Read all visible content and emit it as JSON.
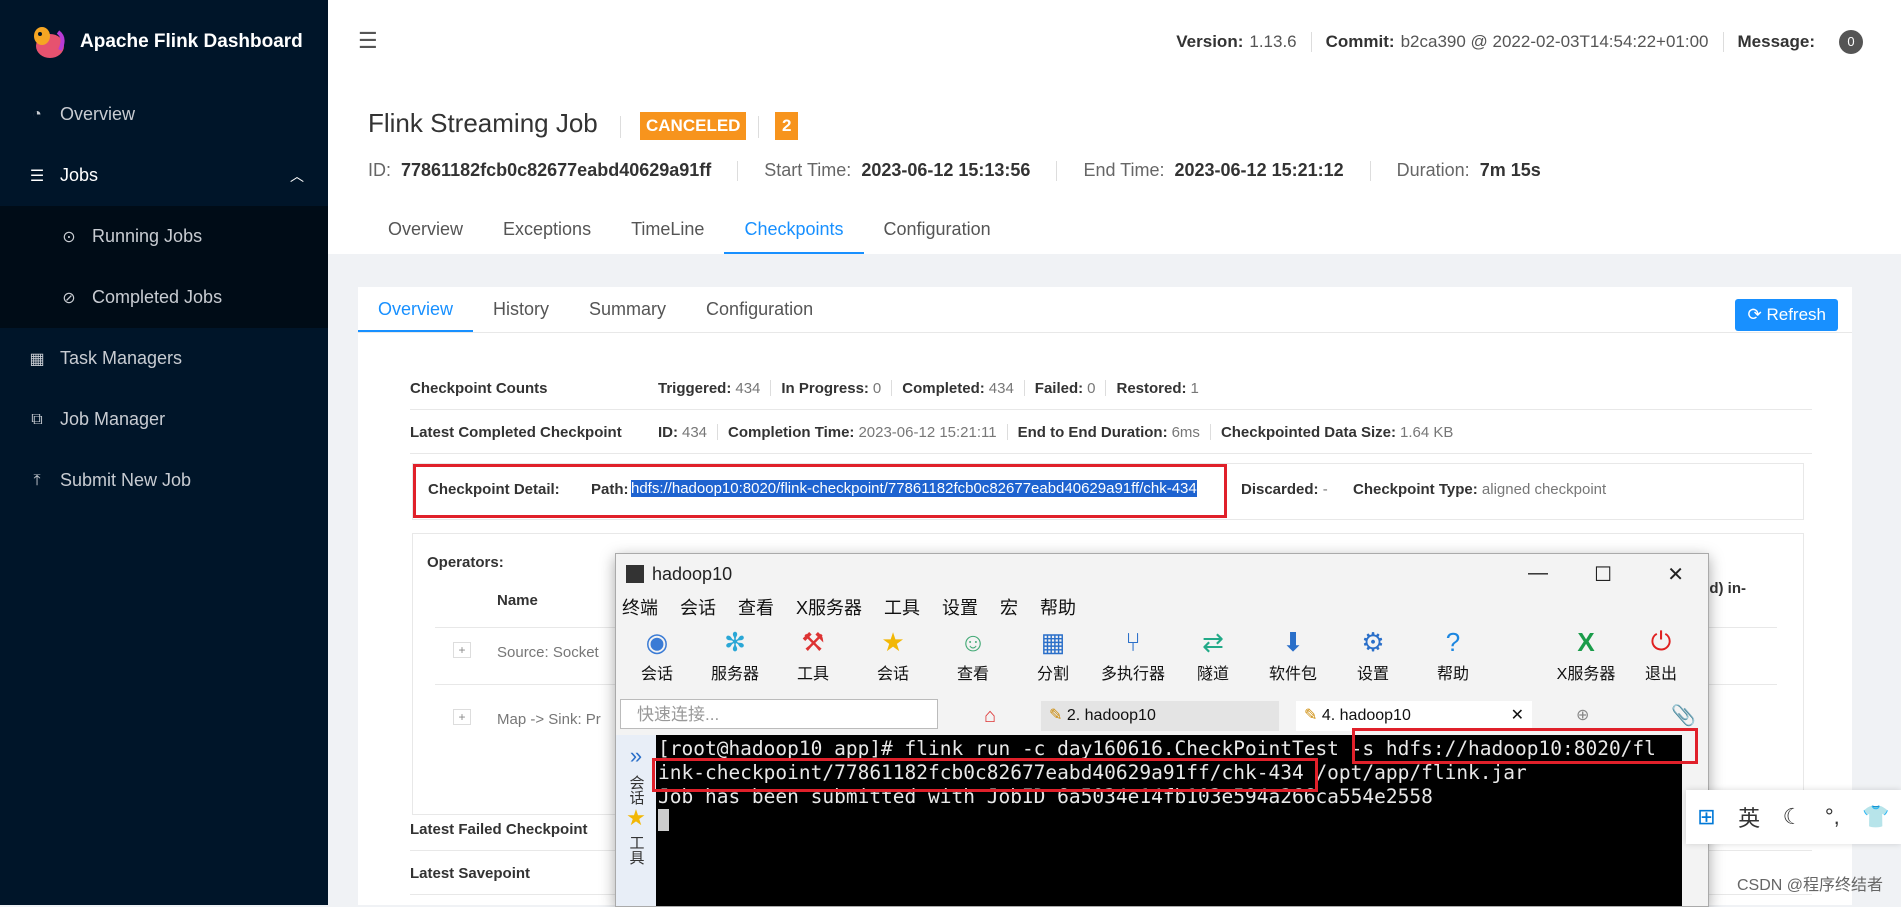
{
  "app": {
    "title": "Apache Flink Dashboard"
  },
  "sidebar": {
    "items": [
      {
        "label": "Overview"
      },
      {
        "label": "Jobs"
      },
      {
        "label": "Running Jobs"
      },
      {
        "label": "Completed Jobs"
      },
      {
        "label": "Task Managers"
      },
      {
        "label": "Job Manager"
      },
      {
        "label": "Submit New Job"
      }
    ]
  },
  "header": {
    "version_label": "Version:",
    "version": "1.13.6",
    "commit_label": "Commit:",
    "commit": "b2ca390 @ 2022-02-03T14:54:22+01:00",
    "message_label": "Message:",
    "message_count": "0"
  },
  "job": {
    "title": "Flink Streaming Job",
    "status": "CANCELED",
    "count": "2",
    "id_label": "ID:",
    "id": "77861182fcb0c82677eabd40629a91ff",
    "start_label": "Start Time:",
    "start": "2023-06-12 15:13:56",
    "end_label": "End Time:",
    "end": "2023-06-12 15:21:12",
    "duration_label": "Duration:",
    "duration": "7m 15s",
    "tabs": [
      "Overview",
      "Exceptions",
      "TimeLine",
      "Checkpoints",
      "Configuration"
    ]
  },
  "checkpoints": {
    "tabs": [
      "Overview",
      "History",
      "Summary",
      "Configuration"
    ],
    "refresh": "Refresh",
    "counts": {
      "label": "Checkpoint Counts",
      "triggered_label": "Triggered:",
      "triggered": "434",
      "in_progress_label": "In Progress:",
      "in_progress": "0",
      "completed_label": "Completed:",
      "completed": "434",
      "failed_label": "Failed:",
      "failed": "0",
      "restored_label": "Restored:",
      "restored": "1"
    },
    "latest": {
      "label": "Latest Completed Checkpoint",
      "id_label": "ID:",
      "id": "434",
      "completion_label": "Completion Time:",
      "completion": "2023-06-12 15:21:11",
      "e2e_label": "End to End Duration:",
      "e2e": "6ms",
      "size_label": "Checkpointed Data Size:",
      "size": "1.64 KB"
    },
    "detail": {
      "label": "Checkpoint Detail:",
      "path_label": "Path:",
      "path": "hdfs://hadoop10:8020/flink-checkpoint/77861182fcb0c82677eabd40629a91ff/chk-434",
      "discarded_label": "Discarded:",
      "discarded": "-",
      "type_label": "Checkpoint Type:",
      "type": "aligned checkpoint"
    },
    "operators": {
      "label": "Operators:",
      "name_header": "Name",
      "partial_header": "ed) in-",
      "rows": [
        "Source: Socket",
        "Map -> Sink: Pr"
      ]
    },
    "latest_failed": "Latest Failed Checkpoint",
    "latest_savepoint": "Latest Savepoint"
  },
  "terminal": {
    "title": "hadoop10",
    "menu": [
      "终端",
      "会话",
      "查看",
      "X服务器",
      "工具",
      "设置",
      "宏",
      "帮助"
    ],
    "tools": [
      "会话",
      "服务器",
      "工具",
      "会话",
      "查看",
      "分割",
      "多执行器",
      "隧道",
      "软件包",
      "设置",
      "帮助",
      "X服务器",
      "退出"
    ],
    "quick_connect": "快速连接...",
    "tabs": [
      "2. hadoop10",
      "4. hadoop10"
    ],
    "side_labels": [
      "会话",
      "工具"
    ],
    "lines": [
      "[root@hadoop10 app]# flink run -c day160616.CheckPointTest -s hdfs://hadoop10:8020/fl",
      "ink-checkpoint/77861182fcb0c82677eabd40629a91ff/chk-434 /opt/app/flink.jar",
      "Job has been submitted with JobID 6a5034e14fb103e594a266ca554e2558"
    ]
  },
  "ime": {
    "label": "英"
  },
  "watermark": "CSDN @程序终结者"
}
